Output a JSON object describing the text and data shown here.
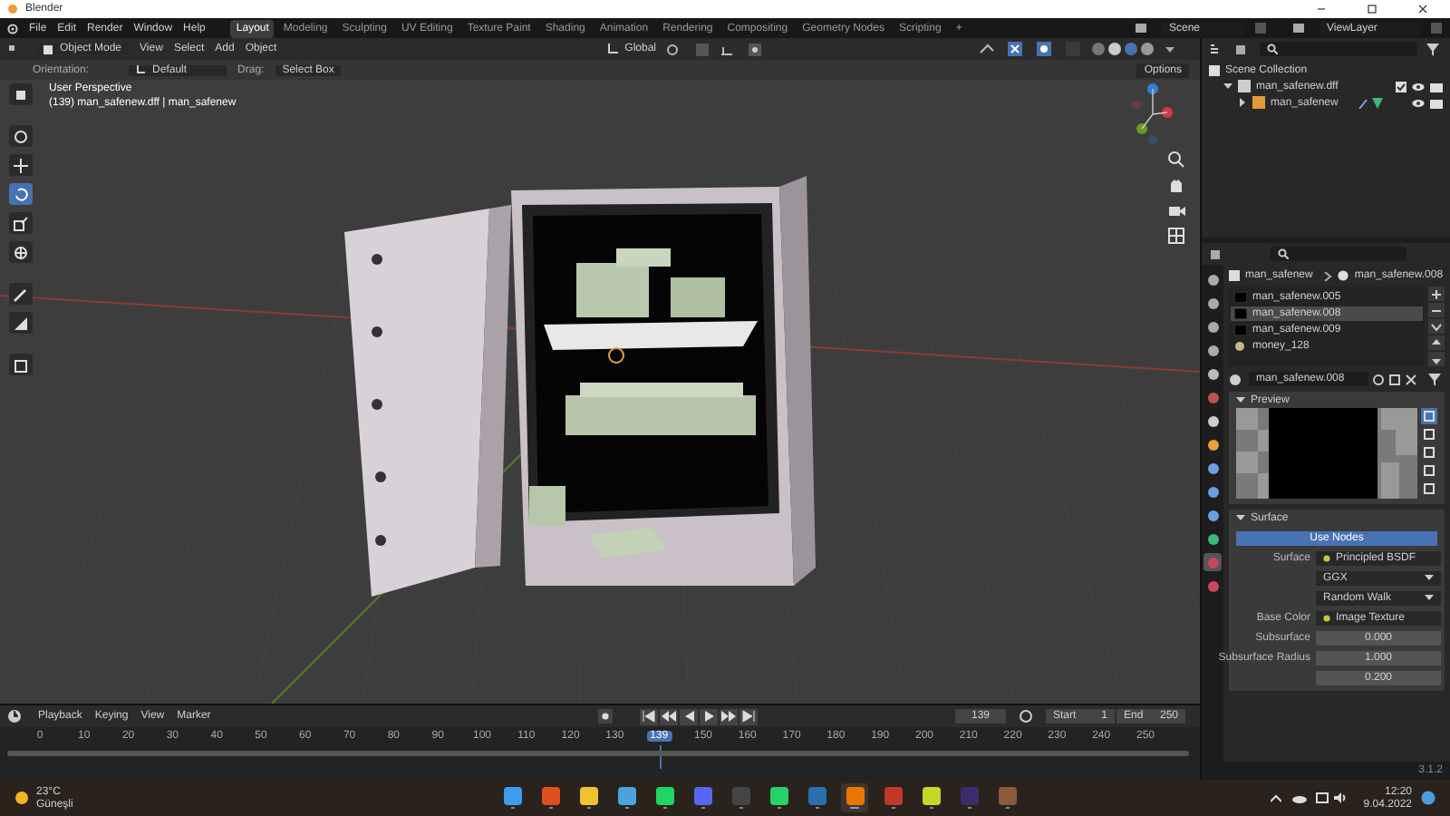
{
  "window": {
    "title": "Blender"
  },
  "menu": [
    "File",
    "Edit",
    "Render",
    "Window",
    "Help"
  ],
  "workspaces": [
    {
      "label": "Layout",
      "selected": true
    },
    {
      "label": "Modeling",
      "selected": false
    },
    {
      "label": "Sculpting",
      "selected": false
    },
    {
      "label": "UV Editing",
      "selected": false
    },
    {
      "label": "Texture Paint",
      "selected": false
    },
    {
      "label": "Shading",
      "selected": false
    },
    {
      "label": "Animation",
      "selected": false
    },
    {
      "label": "Rendering",
      "selected": false
    },
    {
      "label": "Compositing",
      "selected": false
    },
    {
      "label": "Geometry Nodes",
      "selected": false
    },
    {
      "label": "Scripting",
      "selected": false
    },
    {
      "label": "+",
      "selected": false
    }
  ],
  "scene": "Scene",
  "view_layer": "ViewLayer",
  "viewport_header": {
    "mode": "Object Mode",
    "menus": [
      "View",
      "Select",
      "Add",
      "Object"
    ],
    "transform": "Global",
    "options": "Options"
  },
  "tool_settings": {
    "orientation_label": "Orientation:",
    "orientation": "Default",
    "drag_label": "Drag:",
    "drag": "Select Box"
  },
  "viewport": {
    "title": "User Perspective",
    "info": "(139) man_safenew.dff | man_safenew"
  },
  "tools": [
    {
      "kind": "select",
      "selected": false
    },
    {
      "kind": "cursor",
      "selected": false
    },
    {
      "kind": "move",
      "selected": false
    },
    {
      "kind": "rotate",
      "selected": true
    },
    {
      "kind": "scale",
      "selected": false
    },
    {
      "kind": "transform",
      "selected": false
    },
    {
      "kind": "annotate",
      "selected": false
    },
    {
      "kind": "measure",
      "selected": false
    },
    {
      "kind": "add",
      "selected": false
    }
  ],
  "outliner": {
    "root": "Scene Collection",
    "children": [
      {
        "name": "man_safenew.dff",
        "kind": "collection",
        "expanded": true,
        "checked": true,
        "children": [
          {
            "name": "man_safenew",
            "kind": "object",
            "expanded": false
          }
        ]
      }
    ]
  },
  "properties": {
    "object": "man_safenew",
    "material": "man_safenew.008",
    "tabs": [
      {
        "kind": "tool",
        "selected": false
      },
      {
        "kind": "render",
        "selected": false
      },
      {
        "kind": "output",
        "selected": false
      },
      {
        "kind": "view",
        "selected": false
      },
      {
        "kind": "scene",
        "selected": false
      },
      {
        "kind": "world",
        "selected": false
      },
      {
        "kind": "collection",
        "selected": false
      },
      {
        "kind": "object",
        "selected": false
      },
      {
        "kind": "modifier",
        "selected": false
      },
      {
        "kind": "particles",
        "selected": false
      },
      {
        "kind": "physics",
        "selected": false
      },
      {
        "kind": "data",
        "selected": false
      },
      {
        "kind": "material",
        "selected": true
      },
      {
        "kind": "texture",
        "selected": false
      }
    ],
    "slots": [
      {
        "name": "man_safenew.005",
        "selected": false
      },
      {
        "name": "man_safenew.008",
        "selected": true
      },
      {
        "name": "man_safenew.009",
        "selected": false
      },
      {
        "name": "money_128",
        "selected": false
      }
    ],
    "material_name": "man_safenew.008",
    "preview": {
      "title": "Preview",
      "expanded": true
    },
    "surface": {
      "title": "Surface",
      "expanded": true,
      "use_nodes": "Use Nodes",
      "rows": [
        {
          "kind": "link",
          "label": "Surface",
          "value": "Principled BSDF"
        },
        {
          "kind": "dropdown",
          "value": "GGX"
        },
        {
          "kind": "dropdown",
          "value": "Random Walk"
        },
        {
          "kind": "link",
          "label": "Base Color",
          "value": "Image Texture"
        },
        {
          "kind": "number",
          "label": "Subsurface",
          "value": "0.000"
        },
        {
          "kind": "number",
          "label": "Subsurface Radius",
          "value": "1.000"
        },
        {
          "kind": "number",
          "value": "0.200"
        }
      ]
    }
  },
  "timeline": {
    "menus": [
      "Playback",
      "Keying",
      "View",
      "Marker"
    ],
    "current_frame": "139",
    "start_label": "Start",
    "start": "1",
    "end_label": "End",
    "end": "250",
    "ruler": [
      {
        "label": "0",
        "selected": false
      },
      {
        "label": "10",
        "selected": false
      },
      {
        "label": "20",
        "selected": false
      },
      {
        "label": "30",
        "selected": false
      },
      {
        "label": "40",
        "selected": false
      },
      {
        "label": "50",
        "selected": false
      },
      {
        "label": "60",
        "selected": false
      },
      {
        "label": "70",
        "selected": false
      },
      {
        "label": "80",
        "selected": false
      },
      {
        "label": "90",
        "selected": false
      },
      {
        "label": "100",
        "selected": false
      },
      {
        "label": "110",
        "selected": false
      },
      {
        "label": "120",
        "selected": false
      },
      {
        "label": "130",
        "selected": false
      },
      {
        "label": "139",
        "selected": true
      },
      {
        "label": "150",
        "selected": false
      },
      {
        "label": "160",
        "selected": false
      },
      {
        "label": "170",
        "selected": false
      },
      {
        "label": "180",
        "selected": false
      },
      {
        "label": "190",
        "selected": false
      },
      {
        "label": "200",
        "selected": false
      },
      {
        "label": "210",
        "selected": false
      },
      {
        "label": "220",
        "selected": false
      },
      {
        "label": "230",
        "selected": false
      },
      {
        "label": "240",
        "selected": false
      },
      {
        "label": "250",
        "selected": false
      }
    ]
  },
  "version": "3.1.2",
  "taskbar": {
    "weather_temp": "23°C",
    "weather_text": "Güneşli",
    "time": "12:20",
    "date": "9.04.2022",
    "apps": [
      {
        "color": "#3b9cf0",
        "active": false
      },
      {
        "color": "#e0501f",
        "active": false
      },
      {
        "color": "#f2c230",
        "active": false
      },
      {
        "color": "#4aa3df",
        "active": false
      },
      {
        "color": "#1ed760",
        "active": false
      },
      {
        "color": "#5865f2",
        "active": false
      },
      {
        "color": "#444444",
        "active": false
      },
      {
        "color": "#25d366",
        "active": false
      },
      {
        "color": "#2a6fb0",
        "active": false
      },
      {
        "color": "#ea7600",
        "active": true
      },
      {
        "color": "#c0392b",
        "active": false
      },
      {
        "color": "#c8d62a",
        "active": false
      },
      {
        "color": "#3a2d6b",
        "active": false
      },
      {
        "color": "#8a5a3c",
        "active": false
      }
    ]
  }
}
